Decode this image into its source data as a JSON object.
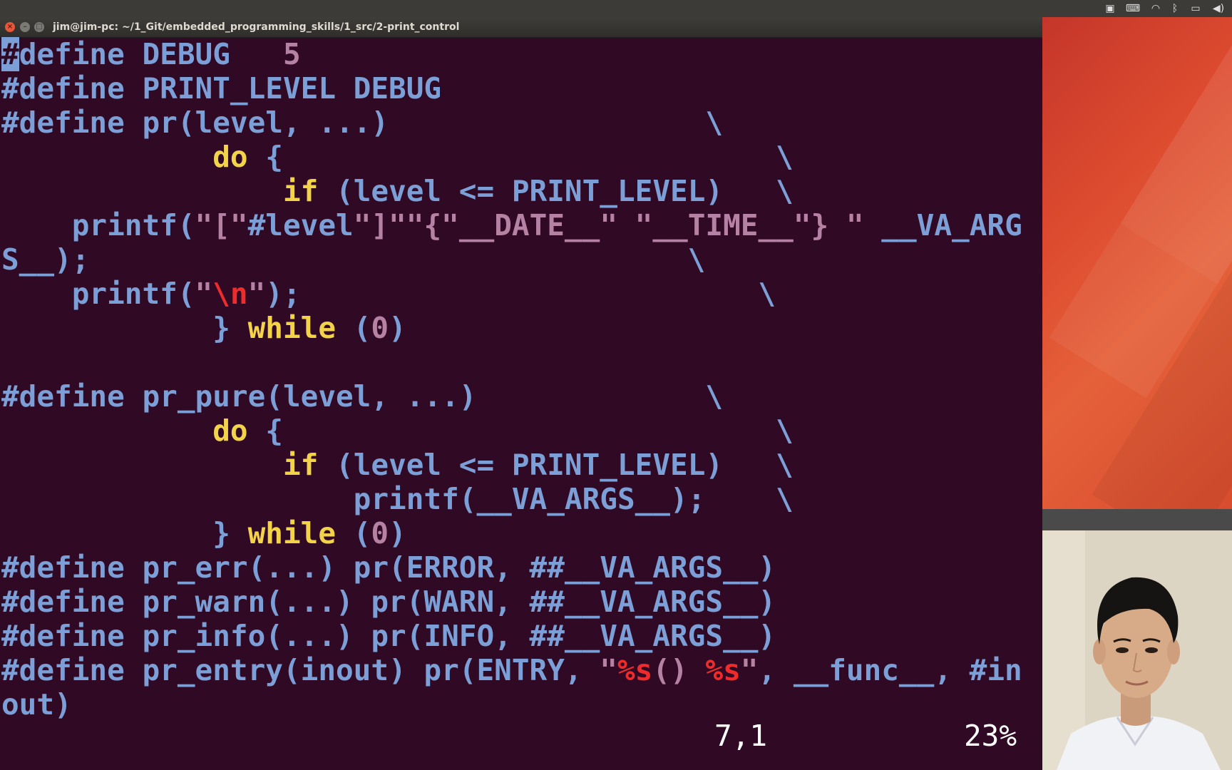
{
  "window": {
    "title": "jim@jim-pc: ~/1_Git/embedded_programming_skills/1_src/2-print_control",
    "close_glyph": "×",
    "min_glyph": "–",
    "max_glyph": "□"
  },
  "editor": {
    "lines": [
      [
        {
          "t": "#",
          "c": "cursor"
        },
        {
          "t": "define DEBUG   ",
          "c": ""
        },
        {
          "t": "5",
          "c": "num"
        }
      ],
      [
        {
          "t": "#define PRINT_LEVEL DEBUG",
          "c": ""
        }
      ],
      [
        {
          "t": "#define pr(level, ...)                  \\",
          "c": ""
        }
      ],
      [
        {
          "t": "            ",
          "c": ""
        },
        {
          "t": "do",
          "c": "kw"
        },
        {
          "t": " {                            \\",
          "c": ""
        }
      ],
      [
        {
          "t": "                ",
          "c": ""
        },
        {
          "t": "if",
          "c": "kw"
        },
        {
          "t": " (level <= PRINT_LEVEL)   \\",
          "c": ""
        }
      ],
      [
        {
          "t": "    printf(",
          "c": ""
        },
        {
          "t": "\"[\"",
          "c": "str"
        },
        {
          "t": "#level",
          "c": ""
        },
        {
          "t": "\"]\"",
          "c": "str"
        },
        {
          "t": "\"{\"",
          "c": "str"
        },
        {
          "t": "__DATE__",
          "c": "str"
        },
        {
          "t": "\" \"",
          "c": "str"
        },
        {
          "t": "__TIME__",
          "c": "str"
        },
        {
          "t": "\"} \"",
          "c": "str"
        },
        {
          "t": " __VA_ARG",
          "c": ""
        }
      ],
      [
        {
          "t": "S__);                                  \\",
          "c": ""
        }
      ],
      [
        {
          "t": "    printf(",
          "c": ""
        },
        {
          "t": "\"",
          "c": "str"
        },
        {
          "t": "\\n",
          "c": "esc"
        },
        {
          "t": "\"",
          "c": "str"
        },
        {
          "t": ");                          \\",
          "c": ""
        }
      ],
      [
        {
          "t": "            } ",
          "c": ""
        },
        {
          "t": "while",
          "c": "kw"
        },
        {
          "t": " (",
          "c": ""
        },
        {
          "t": "0",
          "c": "num"
        },
        {
          "t": ")",
          "c": ""
        }
      ],
      [
        {
          "t": "",
          "c": ""
        }
      ],
      [
        {
          "t": "#define pr_pure(level, ...)             \\",
          "c": ""
        }
      ],
      [
        {
          "t": "            ",
          "c": ""
        },
        {
          "t": "do",
          "c": "kw"
        },
        {
          "t": " {                            \\",
          "c": ""
        }
      ],
      [
        {
          "t": "                ",
          "c": ""
        },
        {
          "t": "if",
          "c": "kw"
        },
        {
          "t": " (level <= PRINT_LEVEL)   \\",
          "c": ""
        }
      ],
      [
        {
          "t": "                    printf(__VA_ARGS__);    \\",
          "c": ""
        }
      ],
      [
        {
          "t": "            } ",
          "c": ""
        },
        {
          "t": "while",
          "c": "kw"
        },
        {
          "t": " (",
          "c": ""
        },
        {
          "t": "0",
          "c": "num"
        },
        {
          "t": ")",
          "c": ""
        }
      ],
      [
        {
          "t": "#define pr_err(...) pr(ERROR, ##__VA_ARGS__)",
          "c": ""
        }
      ],
      [
        {
          "t": "#define pr_warn(...) pr(WARN, ##__VA_ARGS__)",
          "c": ""
        }
      ],
      [
        {
          "t": "#define pr_info(...) pr(INFO, ##__VA_ARGS__)",
          "c": ""
        }
      ],
      [
        {
          "t": "#define pr_entry(inout) pr(ENTRY, ",
          "c": ""
        },
        {
          "t": "\"",
          "c": "str"
        },
        {
          "t": "%s",
          "c": "esc"
        },
        {
          "t": "() ",
          "c": "str"
        },
        {
          "t": "%s",
          "c": "esc"
        },
        {
          "t": "\"",
          "c": "str"
        },
        {
          "t": ", __func__, #in",
          "c": ""
        }
      ],
      [
        {
          "t": "out)",
          "c": ""
        }
      ]
    ]
  },
  "status": {
    "position": "7,1",
    "percent": "23%"
  },
  "tray": {
    "icons": [
      "camera-icon",
      "keyboard-icon",
      "wifi-icon",
      "bluetooth-icon",
      "battery-icon",
      "volume-icon"
    ],
    "glyphs": [
      "▣",
      "⌨",
      "◠",
      "ᛒ",
      "▭",
      "◀)"
    ]
  }
}
